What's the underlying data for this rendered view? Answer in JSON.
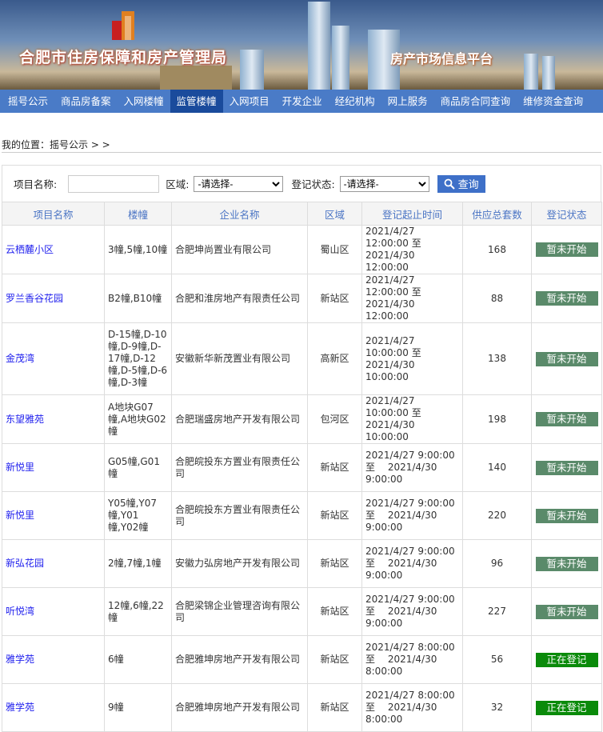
{
  "banner": {
    "title": "合肥市住房保障和房产管理局",
    "subtitle": "房产市场信息平台"
  },
  "nav": [
    "摇号公示",
    "商品房备案",
    "入网楼幢",
    "监管楼幢",
    "入网项目",
    "开发企业",
    "经纪机构",
    "网上服务",
    "商品房合同查询",
    "维修资金查询"
  ],
  "nav_active": 3,
  "breadcrumb": "我的位置：摇号公示 > >",
  "search": {
    "name_label": "项目名称:",
    "name_value": "",
    "region_label": "区域:",
    "region_value": "-请选择-",
    "status_label": "登记状态:",
    "status_value": "-请选择-",
    "button": "查询"
  },
  "columns": [
    "项目名称",
    "楼幢",
    "企业名称",
    "区域",
    "登记起止时间",
    "供应总套数",
    "登记状态"
  ],
  "colors": {
    "not_started": "#5a8a6a",
    "registering": "#0a8a0a",
    "nav": "#4a7bc7"
  },
  "rows": [
    {
      "name": "云栖麓小区",
      "bld": "3幢,5幢,10幢",
      "co": "合肥坤尚置业有限公司",
      "area": "蜀山区",
      "time": "2021/4/27 12:00:00 至　 2021/4/30 12:00:00",
      "num": "168",
      "status": "暂未开始",
      "h": 60
    },
    {
      "name": "罗兰香谷花园",
      "bld": "B2幢,B10幢",
      "co": "合肥和淮房地产有限责任公司",
      "area": "新站区",
      "time": "2021/4/27 12:00:00 至　 2021/4/30 12:00:00",
      "num": "88",
      "status": "暂未开始",
      "h": 60
    },
    {
      "name": "金茂湾",
      "bld": "D-15幢,D-10幢,D-9幢,D-17幢,D-12幢,D-5幢,D-6幢,D-3幢",
      "co": "安徽新华新茂置业有限公司",
      "area": "高新区",
      "time": "2021/4/27 10:00:00 至　 2021/4/30 10:00:00",
      "num": "138",
      "status": "暂未开始",
      "h": 90
    },
    {
      "name": "东望雅苑",
      "bld": "A地块G07幢,A地块G02幢",
      "co": "合肥瑞盛房地产开发有限公司",
      "area": "包河区",
      "time": "2021/4/27 10:00:00 至　 2021/4/30 10:00:00",
      "num": "198",
      "status": "暂未开始",
      "h": 60
    },
    {
      "name": "新悦里",
      "bld": "G05幢,G01幢",
      "co": "合肥皖投东方置业有限责任公司",
      "area": "新站区",
      "time": "2021/4/27 9:00:00 至　 2021/4/30 9:00:00",
      "num": "140",
      "status": "暂未开始",
      "h": 60
    },
    {
      "name": "新悦里",
      "bld": "Y05幢,Y07幢,Y01幢,Y02幢",
      "co": "合肥皖投东方置业有限责任公司",
      "area": "新站区",
      "time": "2021/4/27 9:00:00 至　 2021/4/30 9:00:00",
      "num": "220",
      "status": "暂未开始",
      "h": 60
    },
    {
      "name": "新弘花园",
      "bld": "2幢,7幢,1幢",
      "co": "安徽力弘房地产开发有限公司",
      "area": "新站区",
      "time": "2021/4/27 9:00:00 至　 2021/4/30 9:00:00",
      "num": "96",
      "status": "暂未开始",
      "h": 60
    },
    {
      "name": "听悦湾",
      "bld": "12幢,6幢,22幢",
      "co": "合肥梁锦企业管理咨询有限公司",
      "area": "新站区",
      "time": "2021/4/27 9:00:00 至　 2021/4/30 9:00:00",
      "num": "227",
      "status": "暂未开始",
      "h": 60
    },
    {
      "name": "雅学苑",
      "bld": "6幢",
      "co": "合肥雅坤房地产开发有限公司",
      "area": "新站区",
      "time": "2021/4/27 8:00:00 至　 2021/4/30 8:00:00",
      "num": "56",
      "status": "正在登记",
      "h": 60
    },
    {
      "name": "雅学苑",
      "bld": "9幢",
      "co": "合肥雅坤房地产开发有限公司",
      "area": "新站区",
      "time": "2021/4/27 8:00:00 至　 2021/4/30 8:00:00",
      "num": "32",
      "status": "正在登记",
      "h": 60
    }
  ]
}
